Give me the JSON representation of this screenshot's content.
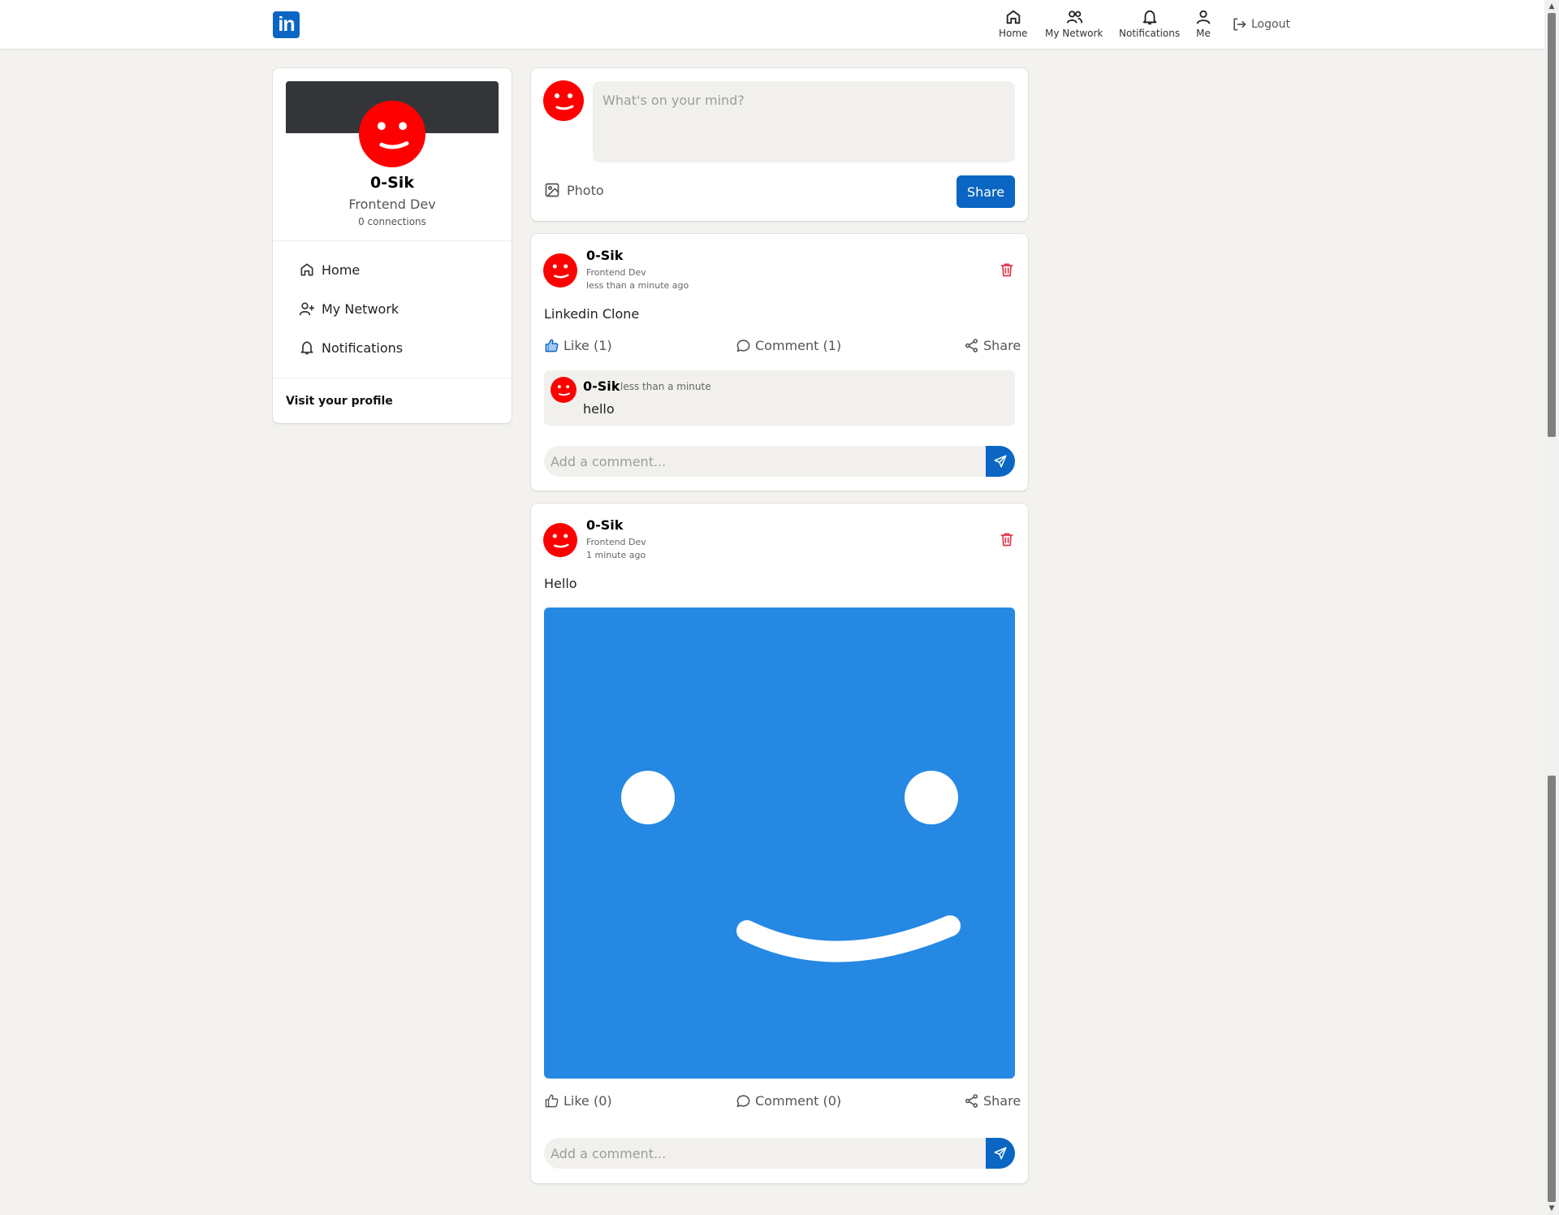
{
  "nav": {
    "logo_text": "in",
    "items": [
      {
        "label": "Home",
        "icon": "home-icon"
      },
      {
        "label": "My Network",
        "icon": "network-icon"
      },
      {
        "label": "Notifications",
        "icon": "bell-icon"
      },
      {
        "label": "Me",
        "icon": "user-icon"
      }
    ],
    "logout_label": "Logout"
  },
  "profile": {
    "name": "0-Sik",
    "title": "Frontend Dev",
    "connections": "0 connections",
    "links": [
      {
        "label": "Home",
        "icon": "home-icon"
      },
      {
        "label": "My Network",
        "icon": "add-user-icon"
      },
      {
        "label": "Notifications",
        "icon": "bell-icon"
      }
    ],
    "visit_label": "Visit your profile"
  },
  "composer": {
    "placeholder": "What's on your mind?",
    "photo_label": "Photo",
    "share_label": "Share"
  },
  "posts": [
    {
      "author": "0-Sik",
      "headline": "Frontend Dev",
      "time": "less than a minute ago",
      "text": "Linkedin Clone",
      "like_label": "Like (1)",
      "liked": true,
      "comment_label": "Comment (1)",
      "share_label": "Share",
      "comments": [
        {
          "author": "0-Sik",
          "time": "less than a minute",
          "text": "hello"
        }
      ],
      "add_comment_placeholder": "Add a comment..."
    },
    {
      "author": "0-Sik",
      "headline": "Frontend Dev",
      "time": "1 minute ago",
      "text": "Hello",
      "has_image": true,
      "like_label": "Like (0)",
      "liked": false,
      "comment_label": "Comment (0)",
      "share_label": "Share",
      "comments": [],
      "add_comment_placeholder": "Add a comment..."
    }
  ],
  "colors": {
    "brand": "#0a66c2",
    "avatar": "#ff0000",
    "image_bg": "#2588e3",
    "delete": "#e0364a"
  }
}
